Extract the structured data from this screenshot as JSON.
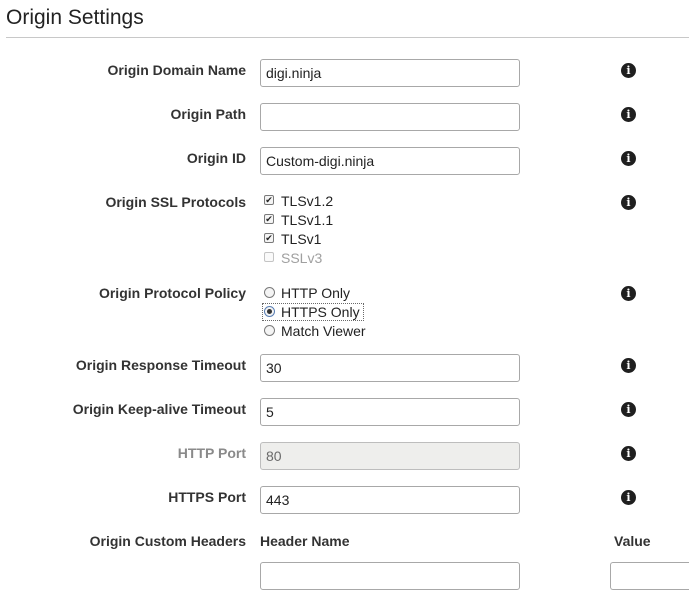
{
  "title": "Origin Settings",
  "fields": {
    "domain_name": {
      "label": "Origin Domain Name",
      "value": "digi.ninja"
    },
    "path": {
      "label": "Origin Path",
      "value": ""
    },
    "origin_id": {
      "label": "Origin ID",
      "value": "Custom-digi.ninja"
    },
    "ssl_protocols": {
      "label": "Origin SSL Protocols",
      "options": [
        {
          "label": "TLSv1.2",
          "checked": true,
          "disabled": false
        },
        {
          "label": "TLSv1.1",
          "checked": true,
          "disabled": false
        },
        {
          "label": "TLSv1",
          "checked": true,
          "disabled": false
        },
        {
          "label": "SSLv3",
          "checked": false,
          "disabled": true
        }
      ]
    },
    "protocol_policy": {
      "label": "Origin Protocol Policy",
      "options": [
        {
          "label": "HTTP Only",
          "selected": false
        },
        {
          "label": "HTTPS Only",
          "selected": true
        },
        {
          "label": "Match Viewer",
          "selected": false
        }
      ]
    },
    "response_timeout": {
      "label": "Origin Response Timeout",
      "value": "30"
    },
    "keepalive_timeout": {
      "label": "Origin Keep-alive Timeout",
      "value": "5"
    },
    "http_port": {
      "label": "HTTP Port",
      "value": "80",
      "disabled": true
    },
    "https_port": {
      "label": "HTTPS Port",
      "value": "443"
    },
    "custom_headers": {
      "label": "Origin Custom Headers",
      "header_name_column": "Header Name",
      "value_column": "Value",
      "header_name_value": "",
      "value_value": ""
    }
  },
  "icons": {
    "info": "info-icon",
    "checked": "checkbox-checked",
    "radio_selected": "radio-selected"
  },
  "colors": {
    "text": "#333333",
    "border": "#a8a8a8",
    "disabled_bg": "#eeeeec",
    "disabled_text": "#8a8a8a"
  }
}
